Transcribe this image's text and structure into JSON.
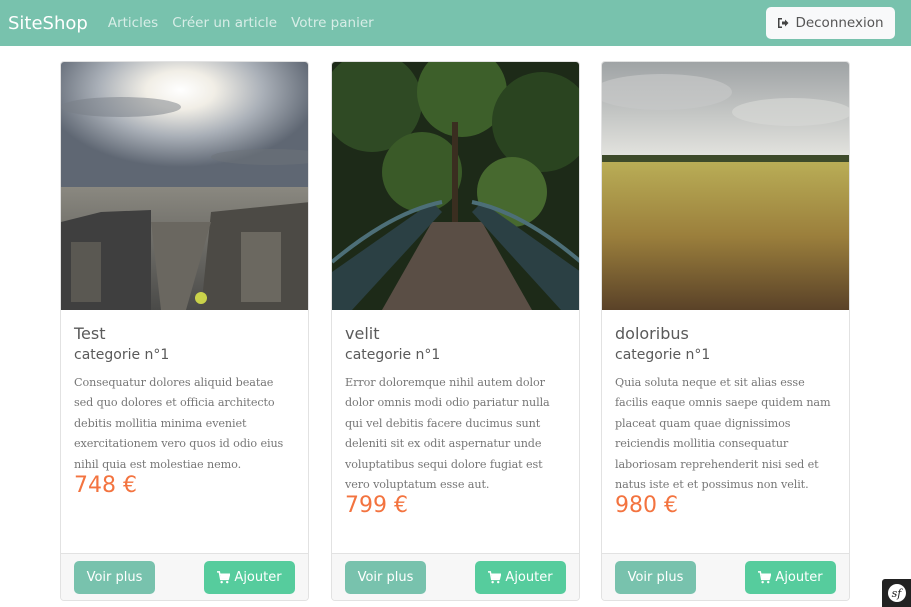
{
  "navbar": {
    "brand": "SiteShop",
    "links": [
      "Articles",
      "Créer un article",
      "Votre panier"
    ],
    "logout_label": "Deconnexion",
    "logout_icon": "sign-out-icon",
    "color": "#78c2ad"
  },
  "products": [
    {
      "title": "Test",
      "category": "categorie n°1",
      "description": "Consequatur dolores aliquid beatae sed quo dolores et officia architecto debitis mollitia minima eveniet exercitationem vero quos id odio eius nihil quia est molestiae nemo.",
      "price": "748 €",
      "image": "city-skyline-image",
      "more_label": "Voir plus",
      "add_label": "Ajouter"
    },
    {
      "title": "velit",
      "category": "categorie n°1",
      "description": "Error doloremque nihil autem dolor dolor omnis modi odio pariatur nulla qui vel debitis facere ducimus sunt deleniti sit ex odit aspernatur unde voluptatibus sequi dolore fugiat est vero voluptatum esse aut.",
      "price": "799 €",
      "image": "forest-bridge-image",
      "more_label": "Voir plus",
      "add_label": "Ajouter"
    },
    {
      "title": "doloribus",
      "category": "categorie n°1",
      "description": "Quia soluta neque et sit alias esse facilis eaque omnis saepe quidem nam placeat quam quae dignissimos reiciendis mollitia consequatur laboriosam reprehenderit nisi sed et natus iste et et possimus non velit.",
      "price": "980 €",
      "image": "wheat-field-image",
      "more_label": "Voir plus",
      "add_label": "Ajouter"
    }
  ],
  "colors": {
    "primary": "#78c2ad",
    "success": "#56cc9d",
    "price": "#f3733f"
  }
}
